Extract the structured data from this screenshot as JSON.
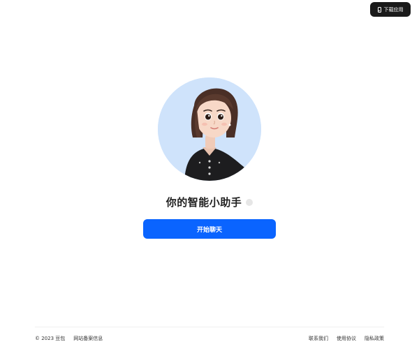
{
  "header": {
    "download_label": "下载应用",
    "download_icon": "phone-icon"
  },
  "main": {
    "title": "你的智能小助手",
    "start_button_label": "开始聊天",
    "avatar_background": "#cfe3fb",
    "accent_color": "#0a64ff"
  },
  "footer": {
    "copyright": "© 2023 豆包",
    "icp": "网站备案信息",
    "links": {
      "contact": "联系我们",
      "terms": "使用协议",
      "privacy": "隐私政策"
    }
  }
}
